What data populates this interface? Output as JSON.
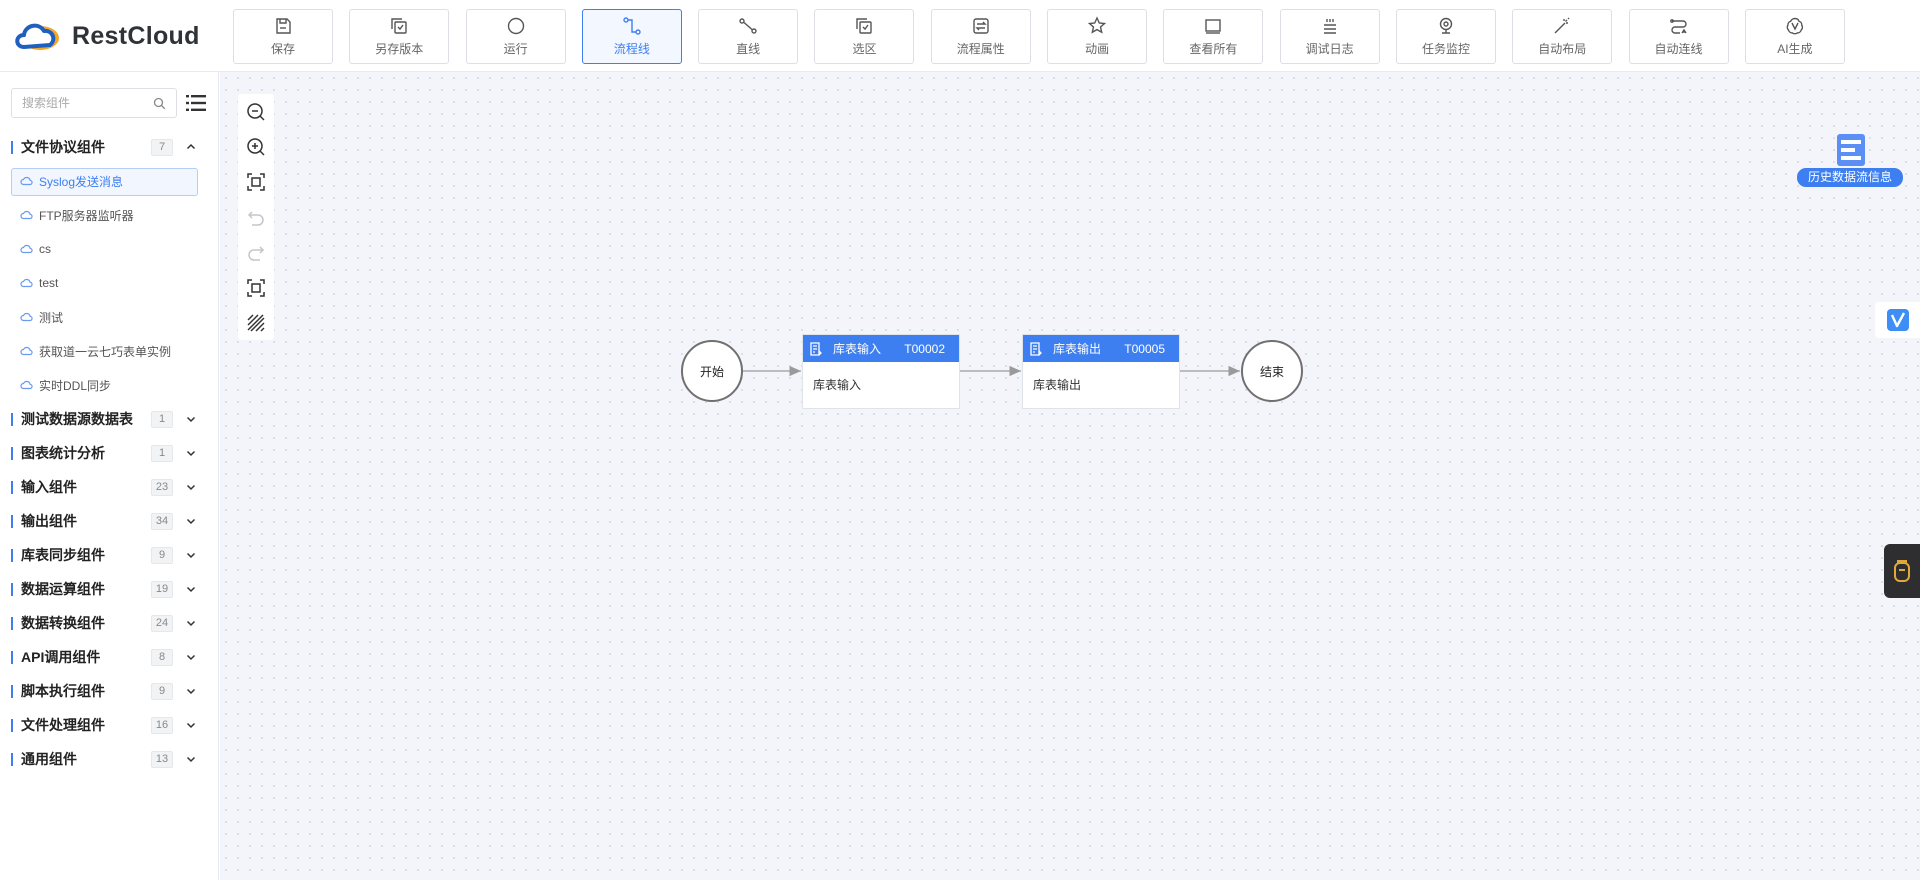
{
  "app": {
    "logo_text": "RestCloud"
  },
  "toolbar": [
    {
      "label": "保存",
      "icon": "save-icon"
    },
    {
      "label": "另存版本",
      "icon": "save-version-icon"
    },
    {
      "label": "运行",
      "icon": "run-icon"
    },
    {
      "label": "流程线",
      "icon": "flow-line-icon",
      "active": true
    },
    {
      "label": "直线",
      "icon": "straight-line-icon"
    },
    {
      "label": "选区",
      "icon": "select-area-icon"
    },
    {
      "label": "流程属性",
      "icon": "flow-properties-icon"
    },
    {
      "label": "动画",
      "icon": "animation-icon"
    },
    {
      "label": "查看所有",
      "icon": "view-all-icon"
    },
    {
      "label": "调试日志",
      "icon": "debug-log-icon"
    },
    {
      "label": "任务监控",
      "icon": "task-monitor-icon"
    },
    {
      "label": "自动布局",
      "icon": "auto-layout-icon"
    },
    {
      "label": "自动连线",
      "icon": "auto-connect-icon"
    },
    {
      "label": "AI生成",
      "icon": "ai-generate-icon"
    }
  ],
  "sidebar": {
    "search_placeholder": "搜索组件",
    "groups": [
      {
        "title": "文件协议组件",
        "count": "7",
        "expanded": true,
        "items": [
          "Syslog发送消息",
          "FTP服务器监听器",
          "cs",
          "test",
          "测试",
          "获取道一云七巧表单实例",
          "实时DDL同步"
        ]
      },
      {
        "title": "测试数据源数据表",
        "count": "1"
      },
      {
        "title": "图表统计分析",
        "count": "1"
      },
      {
        "title": "输入组件",
        "count": "23"
      },
      {
        "title": "输出组件",
        "count": "34"
      },
      {
        "title": "库表同步组件",
        "count": "9"
      },
      {
        "title": "数据运算组件",
        "count": "19"
      },
      {
        "title": "数据转换组件",
        "count": "24"
      },
      {
        "title": "API调用组件",
        "count": "8"
      },
      {
        "title": "脚本执行组件",
        "count": "9"
      },
      {
        "title": "文件处理组件",
        "count": "16"
      },
      {
        "title": "通用组件",
        "count": "13"
      }
    ]
  },
  "canvas": {
    "start_label": "开始",
    "end_label": "结束",
    "nodes": [
      {
        "title": "库表输入",
        "code": "T00002",
        "body": "库表输入"
      },
      {
        "title": "库表输出",
        "code": "T00005",
        "body": "库表输出"
      }
    ],
    "history_label": "历史数据流信息"
  },
  "colors": {
    "accent": "#3d7ff0"
  }
}
